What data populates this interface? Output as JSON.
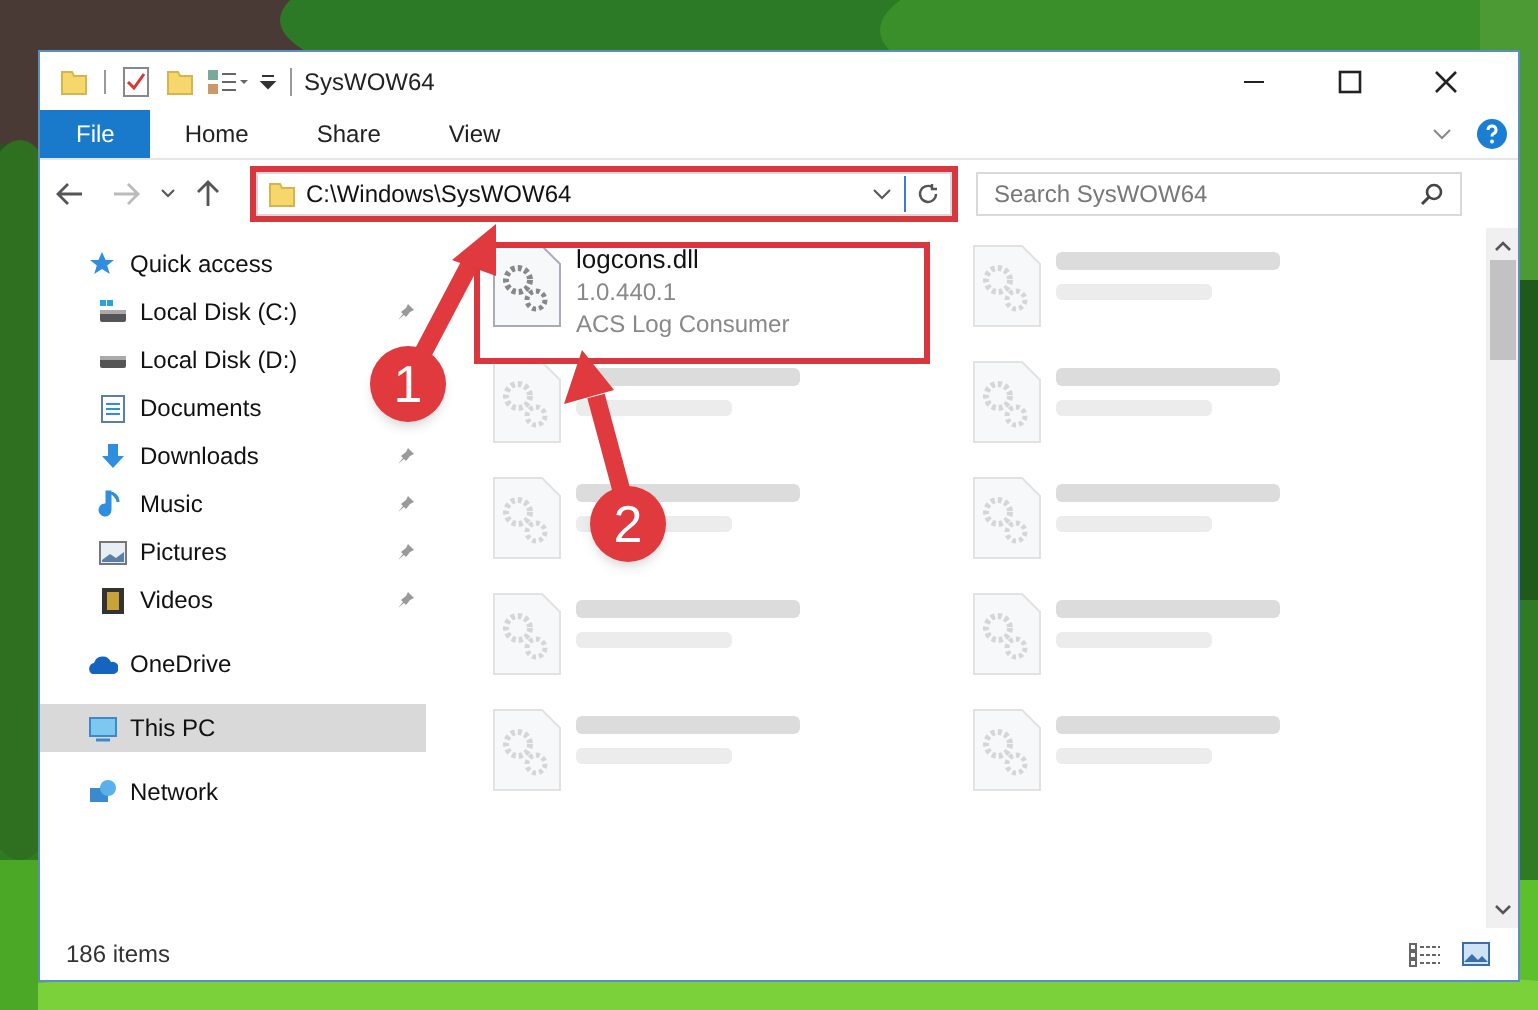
{
  "window": {
    "title": "SysWOW64"
  },
  "ribbon_tabs": [
    {
      "label": "File",
      "selected": true
    },
    {
      "label": "Home",
      "selected": false
    },
    {
      "label": "Share",
      "selected": false
    },
    {
      "label": "View",
      "selected": false
    }
  ],
  "address": {
    "path": "C:\\Windows\\SysWOW64"
  },
  "search": {
    "placeholder": "Search SysWOW64"
  },
  "sidebar": {
    "items": [
      {
        "label": "Quick access",
        "selected": false,
        "children": [
          {
            "label": "Local Disk (C:)",
            "pinned": true,
            "selected": false
          },
          {
            "label": "Local Disk (D:)",
            "selected": false
          },
          {
            "label": "Documents",
            "selected": false
          },
          {
            "label": "Downloads",
            "pinned": true,
            "selected": false
          },
          {
            "label": "Music",
            "pinned": true,
            "selected": false
          },
          {
            "label": "Pictures",
            "pinned": true,
            "selected": false
          },
          {
            "label": "Videos",
            "pinned": true,
            "selected": false
          }
        ]
      },
      {
        "label": "OneDrive",
        "selected": false
      },
      {
        "label": "This PC",
        "selected": true
      },
      {
        "label": "Network",
        "selected": false
      }
    ]
  },
  "files": [
    {
      "kind": "detail",
      "name": "logcons.dll",
      "version": "1.0.440.1",
      "description": "ACS Log Consumer"
    },
    {
      "kind": "blurred"
    },
    {
      "kind": "blurred"
    },
    {
      "kind": "blurred"
    },
    {
      "kind": "blurred"
    },
    {
      "kind": "blurred"
    },
    {
      "kind": "blurred"
    },
    {
      "kind": "blurred"
    },
    {
      "kind": "blurred"
    },
    {
      "kind": "blurred"
    }
  ],
  "status_bar": {
    "item_count": "186 items"
  },
  "callouts": [
    {
      "number": "1"
    },
    {
      "number": "2"
    }
  ]
}
